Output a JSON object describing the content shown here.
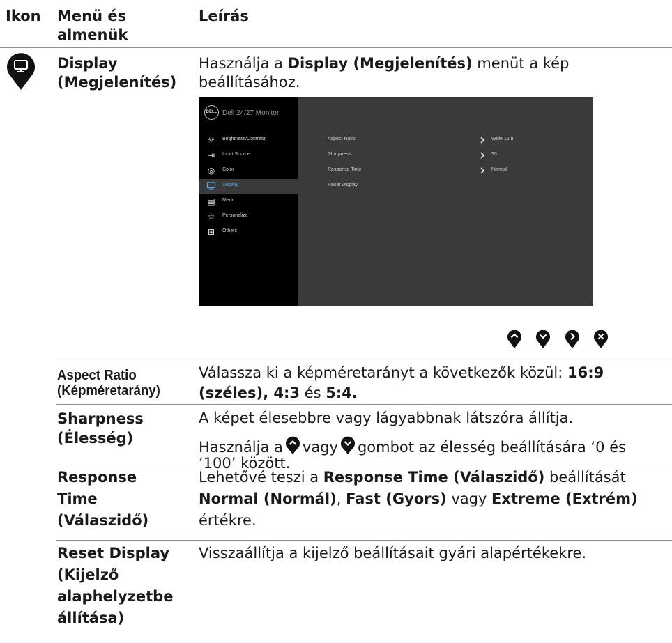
{
  "header": {
    "col_icon": "Ikon",
    "col_menu_1": "Menü és",
    "col_menu_2": "almenük",
    "col_desc": "Leírás"
  },
  "display_section": {
    "icon": "monitor-icon",
    "name_1": "Display",
    "name_2": "(Megjelenítés)",
    "desc_1_pre": "Használja a ",
    "desc_1_bold": "Display (Megjelenítés)",
    "desc_1_post": " menüt a kép",
    "desc_2": "beállításához."
  },
  "osd": {
    "logo": "DELL",
    "title": "Dell 24/27 Monitor",
    "menu": [
      {
        "label": "Brightness/Contrast",
        "icon": "brightness-icon",
        "active": false
      },
      {
        "label": "Input Source",
        "icon": "input-source-icon",
        "active": false
      },
      {
        "label": "Color",
        "icon": "color-palette-icon",
        "active": false
      },
      {
        "label": "Display",
        "icon": "monitor-icon",
        "active": true
      },
      {
        "label": "Menu",
        "icon": "menu-icon",
        "active": false
      },
      {
        "label": "Personalize",
        "icon": "star-icon",
        "active": false
      },
      {
        "label": "Others",
        "icon": "others-icon",
        "active": false
      }
    ],
    "options": [
      {
        "label": "Aspect Ratio",
        "value": "Wide 16:9"
      },
      {
        "label": "Sharpness",
        "value": "50"
      },
      {
        "label": "Response Time",
        "value": "Normal"
      },
      {
        "label": "Reset Display",
        "value": ""
      }
    ]
  },
  "nav_buttons": [
    "up-button-icon",
    "down-button-icon",
    "right-button-icon",
    "close-button-icon"
  ],
  "rows": [
    {
      "name_1": "Aspect Ratio",
      "name_2": "(Képméretarány)",
      "line_1": "Válassza ki a képméretarányt a következők közül: ",
      "line_1_bold": "16:9",
      "line_2_bold": "(széles), 4:3",
      "line_2_mid": " és ",
      "line_2_end_bold": "5:4."
    },
    {
      "name_1": "Sharpness",
      "name_2": "(Élesség)",
      "line_1": "A képet élesebbre vagy lágyabbnak látszóra állítja.",
      "line_2_a": "Használja a",
      "line_2_b": "vagy",
      "line_2_c": "gombot az élesség beállítására ‘0 és",
      "line_3": "‘100’ között."
    },
    {
      "name_1": "Response",
      "name_2": "Time",
      "name_3": "(Válaszidő)",
      "line_1_pre": "Lehetővé teszi a ",
      "line_1_bold": "Response Time (Válaszidő)",
      "line_1_post": " beállítását",
      "line_2_a": "Normal (Normál)",
      "line_2_b": ", ",
      "line_2_c": "Fast (Gyors)",
      "line_2_d": " vagy ",
      "line_2_e": "Extreme (Extrém)",
      "line_3": "értékre."
    },
    {
      "name_1": "Reset Display",
      "name_2": "(Kijelző",
      "name_3": "alaphelyzetbe",
      "name_4": "állítása)",
      "line_1": "Visszaállítja a kijelző beállításait gyári alapértékekre."
    }
  ]
}
